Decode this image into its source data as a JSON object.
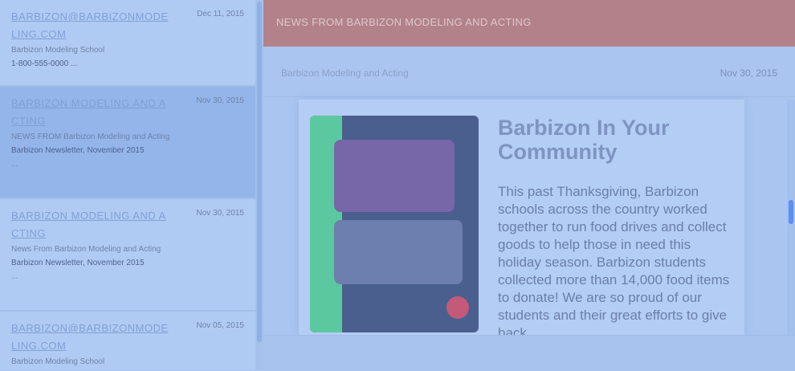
{
  "inbox": {
    "messages": [
      {
        "sender": "BARBIZON@BARBIZONMODELING.COM",
        "date": "Dec 11, 2015",
        "line1": "Barbizon Modeling School",
        "line2": "1-800-555-0000 ..."
      },
      {
        "sender": "BARBIZON MODELING AND ACTING",
        "date": "Nov 30, 2015",
        "line1": "NEWS FROM Barbizon Modeling and Acting",
        "line2": "Barbizon Newsletter, November 2015",
        "line3": "..."
      },
      {
        "sender": "BARBIZON MODELING AND ACTING",
        "date": "Nov 30, 2015",
        "line1": "News From Barbizon Modeling and Acting",
        "line2": "Barbizon Newsletter, November 2015",
        "line3": "..."
      },
      {
        "sender": "BARBIZON@BARBIZONMODELING.COM",
        "date": "Nov 05, 2015",
        "line1": "Barbizon Modeling School",
        "line2": ""
      }
    ]
  },
  "reader": {
    "banner": "NEWS FROM BARBIZON MODELING AND ACTING",
    "from": "Barbizon Modeling and Acting",
    "date": "Nov 30, 2015",
    "article_title": "Barbizon In Your Community",
    "article_text": "This past Thanksgiving, Barbizon schools across the country worked together to run food drives and collect goods to help those in need this holiday season. Barbizon students collected more than 14,000 food items to donate! We are so proud of our students and their great efforts to give back."
  },
  "colors": {
    "banner": "#b38189",
    "selected_row": "#94b5ea",
    "link": "#7f9fd6",
    "scroll_thumb": "#5b8ff0"
  }
}
